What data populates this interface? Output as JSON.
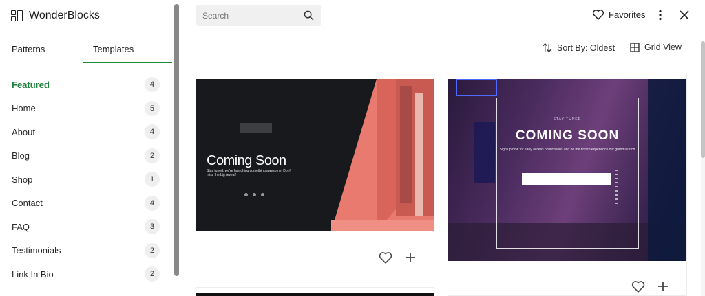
{
  "app": {
    "title": "WonderBlocks"
  },
  "tabs": [
    {
      "label": "Patterns"
    },
    {
      "label": "Templates"
    }
  ],
  "categories": [
    {
      "label": "Featured",
      "count": "4"
    },
    {
      "label": "Home",
      "count": "5"
    },
    {
      "label": "About",
      "count": "4"
    },
    {
      "label": "Blog",
      "count": "2"
    },
    {
      "label": "Shop",
      "count": "1"
    },
    {
      "label": "Contact",
      "count": "4"
    },
    {
      "label": "FAQ",
      "count": "3"
    },
    {
      "label": "Testimonials",
      "count": "2"
    },
    {
      "label": "Link In Bio",
      "count": "2"
    }
  ],
  "search": {
    "placeholder": "Search"
  },
  "header": {
    "favorites_label": "Favorites",
    "sort_label": "Sort By: Oldest",
    "view_label": "Grid View"
  },
  "cards": [
    {
      "title": "Coming Soon",
      "subtitle": "Stay tuned, we're launching something awesome. Don't miss the big reveal!"
    },
    {
      "eyebrow": "STAY TUNED",
      "title": "COMING SOON",
      "subtitle": "Sign up now for early access notifications and be the first to experience our grand launch"
    }
  ],
  "icons": {
    "brand": "blocks-logo-icon",
    "search": "search-icon",
    "favorites": "heart-icon",
    "more": "more-vertical-icon",
    "close": "close-icon",
    "sort": "sort-arrows-icon",
    "grid": "grid-view-icon",
    "favorite_card": "heart-icon",
    "add_card": "plus-icon"
  },
  "colors": {
    "accent": "#1a8a3a",
    "text": "#1e1e1e"
  }
}
